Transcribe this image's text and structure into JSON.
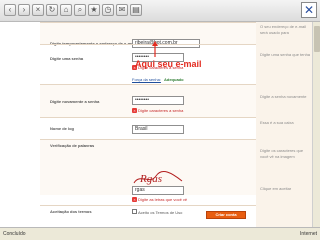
{
  "annotation": "Aqui seu e-mail",
  "form": {
    "email_label": "Digite temporariamente o endereço de e-mail",
    "email_value": "ribeira@hot.com.br",
    "password_label": "Digite uma senha",
    "password_value": "••••••••",
    "password_warning": "Digite caracteres a senha",
    "password_strength_label": "Força da senha:",
    "password_strength_value": "Adequado",
    "confirm_label": "Digite novamente a senha",
    "confirm_value": "••••••••",
    "confirm_warning": "Digite caracteres a senha",
    "country_label": "Nome de log",
    "country_value": "Brasil",
    "captcha_label": "Verificação de palavras",
    "captcha_text": "Rgas",
    "captcha_input_value": "rgas",
    "captcha_warning": "Digite as letras que você vê",
    "terms_label": "Aceitação dos termos",
    "terms_text": "Aceito os Termos de Uso",
    "create_button": "Criar conta"
  },
  "right_help": [
    "O seu endereço de e-mail será usado para",
    "Digite uma senha que tenha",
    "Digite a senha novamente",
    "Essa é a sua caixa",
    "Digite os caracteres que você vê na imagem",
    "Clique em aceitar"
  ],
  "status": {
    "left": "Concluído",
    "right": "Internet"
  },
  "colors": {
    "accent": "#e85d10",
    "annotation": "#e32b20",
    "warning": "#c62828",
    "strength": "#2e7d32"
  }
}
